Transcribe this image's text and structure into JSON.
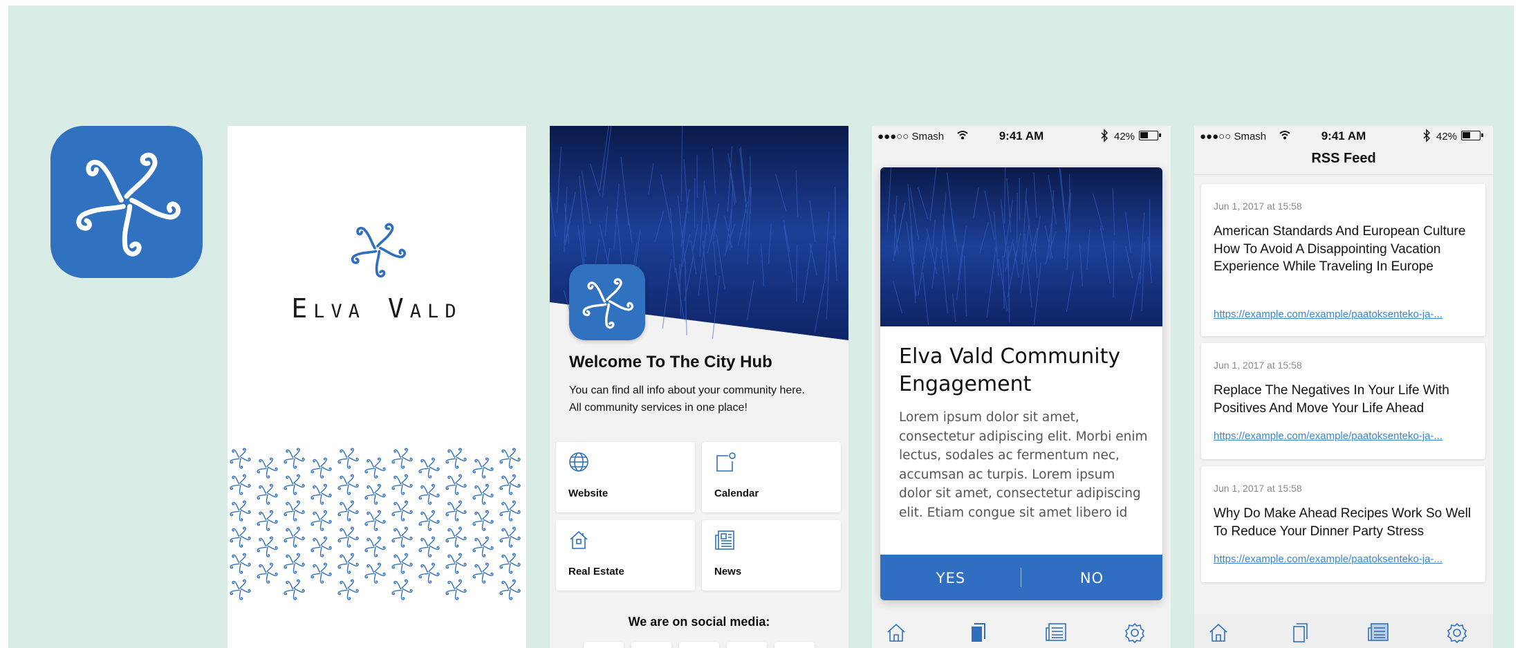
{
  "colors": {
    "background": "#d9ece6",
    "brand_blue": "#3072c0",
    "link_blue": "#3a86d4"
  },
  "splash": {
    "brand_name": "Elva vald",
    "logo_icon": "triskele-star-logo-icon"
  },
  "home": {
    "title": "Welcome To The City Hub",
    "subtitle": "You can find all info about your community here. All community services in one place!",
    "tiles": [
      {
        "label": "Website",
        "icon": "globe-icon"
      },
      {
        "label": "Calendar",
        "icon": "calendar-icon"
      },
      {
        "label": "Real Estate",
        "icon": "house-icon"
      },
      {
        "label": "News",
        "icon": "newspaper-icon"
      }
    ],
    "social_heading": "We are on social media:"
  },
  "status_bar": {
    "carrier": "●●●○○ Smash",
    "time": "9:41 AM",
    "battery": "42%"
  },
  "engagement": {
    "title": "Elva Vald Community Engagement",
    "body": "Lorem ipsum dolor sit amet, consectetur adipiscing elit. Morbi enim lectus, sodales ac fermentum nec, accumsan ac turpis. Lorem ipsum dolor sit amet, consectetur adipiscing elit. Etiam congue sit amet libero id",
    "yes_label": "YES",
    "no_label": "NO"
  },
  "rss": {
    "title": "RSS Feed",
    "items": [
      {
        "date": "Jun 1, 2017 at 15:58",
        "headline": "American Standards And European Culture How To Avoid A Disappointing Vacation Experience While Traveling In Europe",
        "link": "https://example.com/example/paatoksenteko-ja-..."
      },
      {
        "date": "Jun 1, 2017 at 15:58",
        "headline": "Replace The Negatives In Your Life With Positives And Move Your Life Ahead",
        "link": "https://example.com/example/paatoksenteko-ja-..."
      },
      {
        "date": "Jun 1, 2017 at 15:58",
        "headline": "Why Do Make Ahead Recipes Work So Well To Reduce Your Dinner Party Stress",
        "link": "https://example.com/example/paatoksenteko-ja-..."
      }
    ]
  },
  "tabbar": {
    "icons": [
      "home-icon",
      "pages-icon",
      "news-icon",
      "settings-icon"
    ]
  }
}
